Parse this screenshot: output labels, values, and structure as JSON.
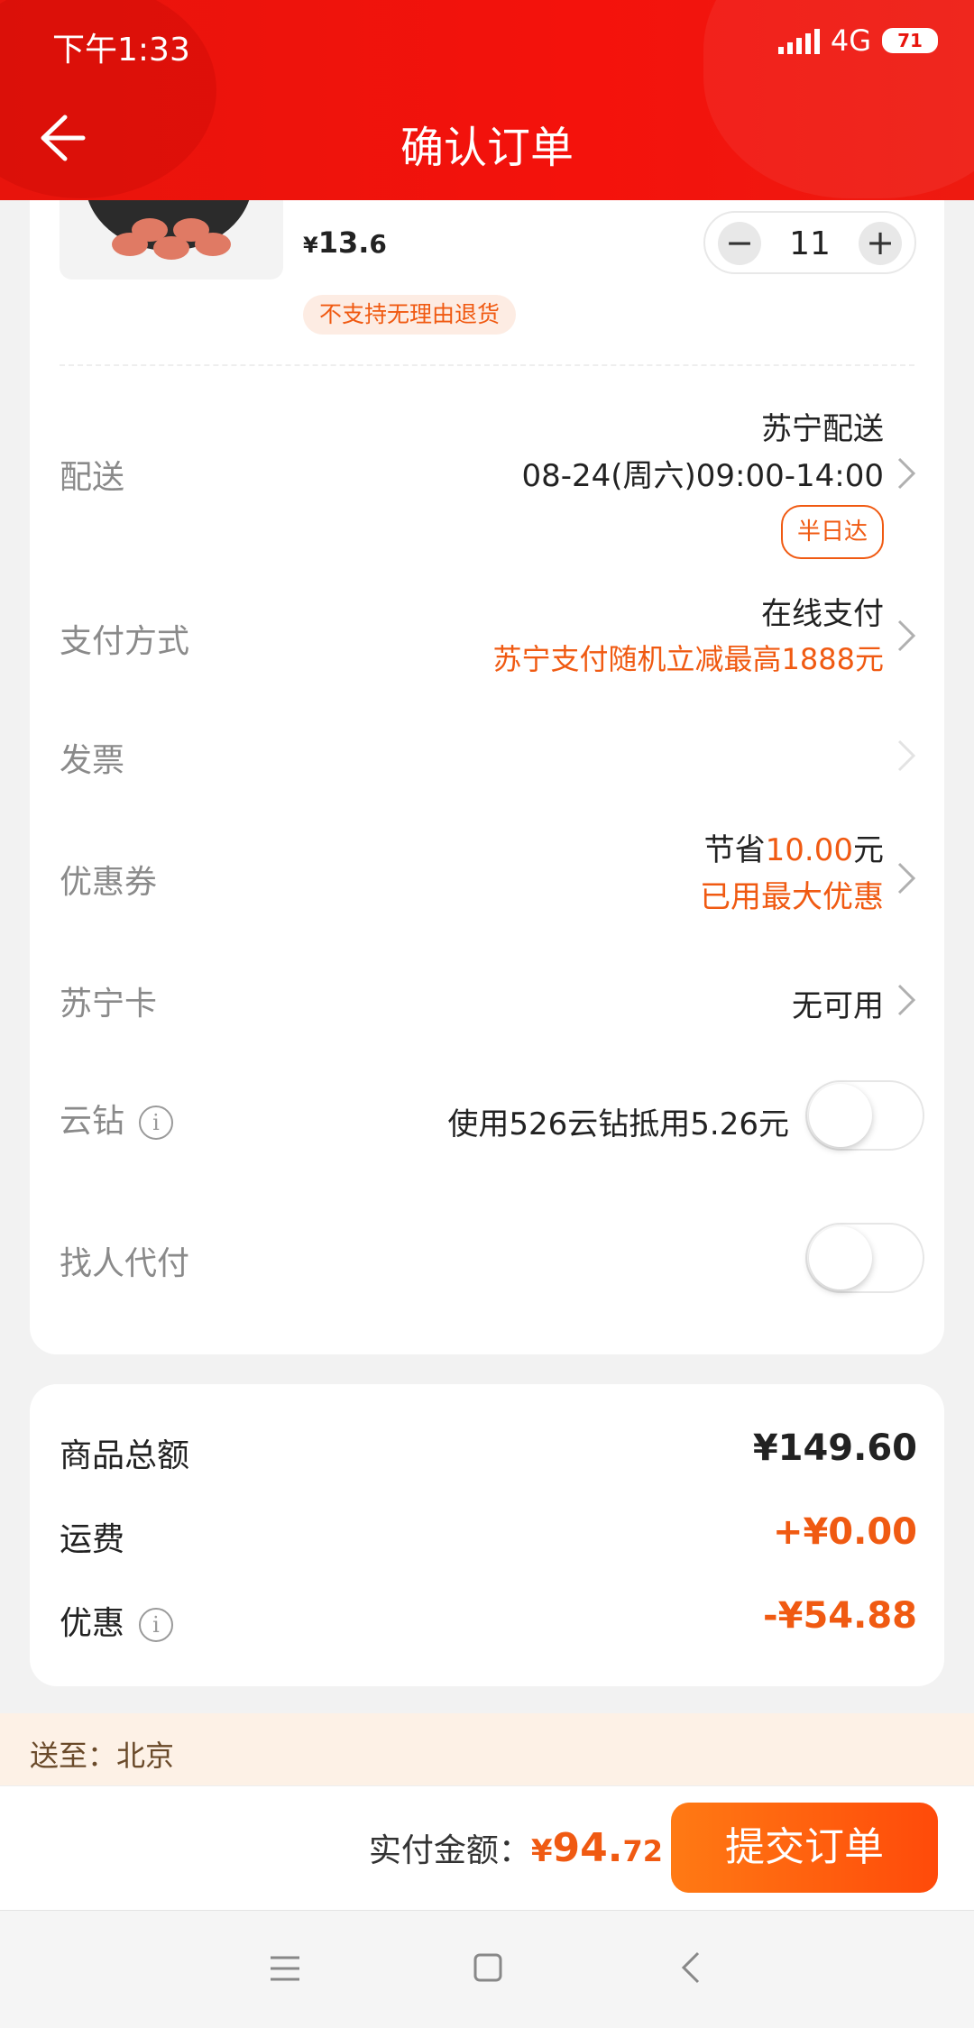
{
  "status_bar": {
    "time": "下午1:33",
    "network": "4G",
    "battery": "71"
  },
  "header": {
    "title": "确认订单"
  },
  "product": {
    "price_symbol": "¥",
    "price_int": "13.",
    "price_dec": "6",
    "quantity": "11",
    "minus": "−",
    "plus": "+",
    "tag": "不支持无理由退货"
  },
  "delivery": {
    "label": "配送",
    "carrier": "苏宁配送",
    "time": "08-24(周六)09:00-14:00",
    "badge": "半日达"
  },
  "payment": {
    "label": "支付方式",
    "method": "在线支付",
    "promo": "苏宁支付随机立减最高1888元"
  },
  "invoice": {
    "label": "发票"
  },
  "coupon": {
    "label": "优惠券",
    "save_prefix": "节省",
    "save_amount": "10.00",
    "save_suffix": "元",
    "status": "已用最大优惠"
  },
  "suning_card": {
    "label": "苏宁卡",
    "value": "无可用"
  },
  "yunzuan": {
    "label": "云钻",
    "info": "i",
    "value": "使用526云钻抵用5.26元",
    "enabled": false
  },
  "pay_for_me": {
    "label": "找人代付",
    "enabled": false
  },
  "summary": {
    "goods_label": "商品总额",
    "goods_value": "¥149.60",
    "shipping_label": "运费",
    "shipping_value": "+¥0.00",
    "discount_label": "优惠",
    "discount_info": "i",
    "discount_value": "-¥54.88"
  },
  "address": {
    "text": "送至：北京"
  },
  "bottom": {
    "total_label": "实付金额：",
    "total_symbol": "¥",
    "total_int": "94.",
    "total_dec": "72",
    "submit": "提交订单"
  },
  "colors": {
    "header_red": "#e8140c",
    "accent_orange": "#f05a12",
    "button_orange": "#ff5a0f"
  },
  "icons": [
    "back-arrow-icon",
    "chevron-right-icon",
    "info-icon",
    "menu-icon",
    "home-icon",
    "back-nav-icon"
  ]
}
